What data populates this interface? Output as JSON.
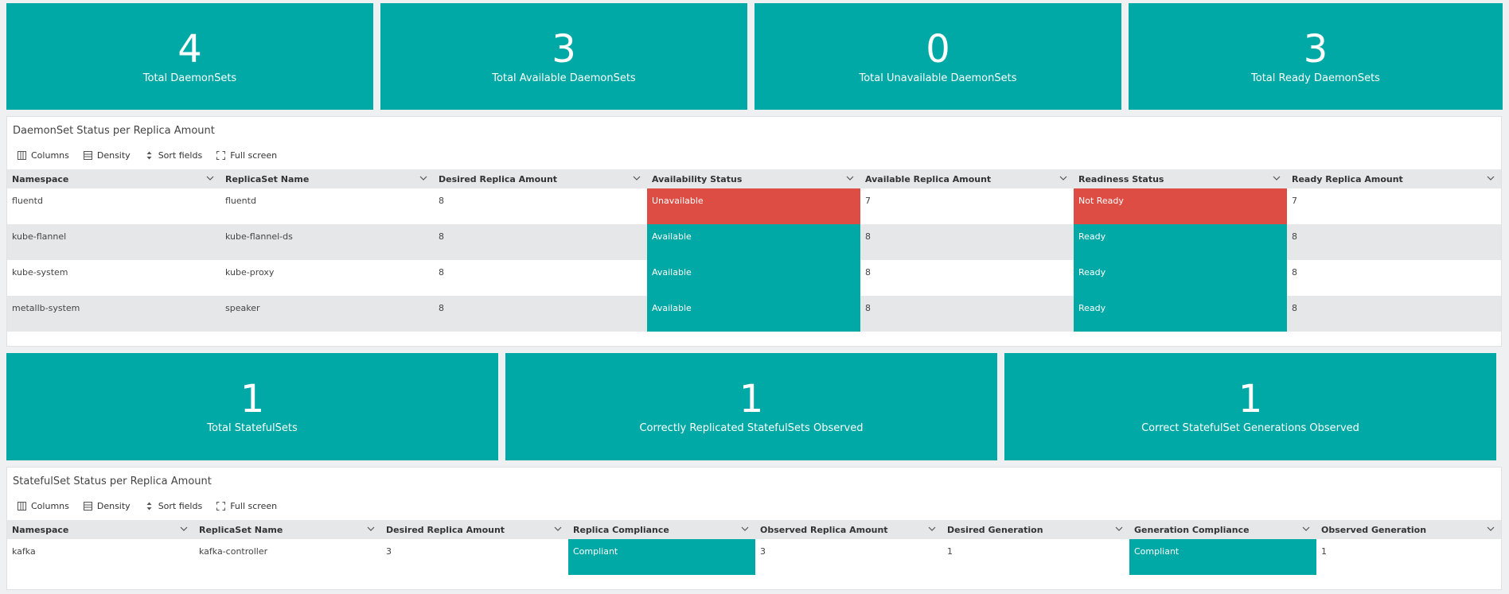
{
  "daemonset_stats": [
    {
      "value": "4",
      "label": "Total DaemonSets"
    },
    {
      "value": "3",
      "label": "Total Available DaemonSets"
    },
    {
      "value": "0",
      "label": "Total Unavailable DaemonSets"
    },
    {
      "value": "3",
      "label": "Total Ready DaemonSets"
    }
  ],
  "toolbar": {
    "columns": "Columns",
    "density": "Density",
    "sort_fields": "Sort fields",
    "full_screen": "Full screen"
  },
  "daemonset_table": {
    "title": "DaemonSet Status per Replica Amount",
    "headers": [
      "Namespace",
      "ReplicaSet Name",
      "Desired Replica Amount",
      "Availability Status",
      "Available Replica Amount",
      "Readiness Status",
      "Ready Replica Amount"
    ],
    "rows": [
      [
        "fluentd",
        "fluentd",
        "8",
        "Unavailable",
        "7",
        "Not Ready",
        "7"
      ],
      [
        "kube-flannel",
        "kube-flannel-ds",
        "8",
        "Available",
        "8",
        "Ready",
        "8"
      ],
      [
        "kube-system",
        "kube-proxy",
        "8",
        "Available",
        "8",
        "Ready",
        "8"
      ],
      [
        "metallb-system",
        "speaker",
        "8",
        "Available",
        "8",
        "Ready",
        "8"
      ]
    ]
  },
  "statefulset_stats": [
    {
      "value": "1",
      "label": "Total StatefulSets"
    },
    {
      "value": "1",
      "label": "Correctly Replicated StatefulSets Observed"
    },
    {
      "value": "1",
      "label": "Correct StatefulSet Generations Observed"
    }
  ],
  "statefulset_table": {
    "title": "StatefulSet Status per Replica Amount",
    "headers": [
      "Namespace",
      "ReplicaSet Name",
      "Desired Replica Amount",
      "Replica Compliance",
      "Observed Replica Amount",
      "Desired Generation",
      "Generation Compliance",
      "Observed Generation"
    ],
    "rows": [
      [
        "kafka",
        "kafka-controller",
        "3",
        "Compliant",
        "3",
        "1",
        "Compliant",
        "1"
      ]
    ]
  },
  "colors": {
    "teal": "#00a9a5",
    "red": "#de4d43",
    "header_gray": "#e6e7e9"
  },
  "icons": {
    "columns": "columns-icon",
    "density": "density-icon",
    "sort": "sort-icon",
    "fullscreen": "fullscreen-icon",
    "header_menu": "chevron-down-icon"
  }
}
